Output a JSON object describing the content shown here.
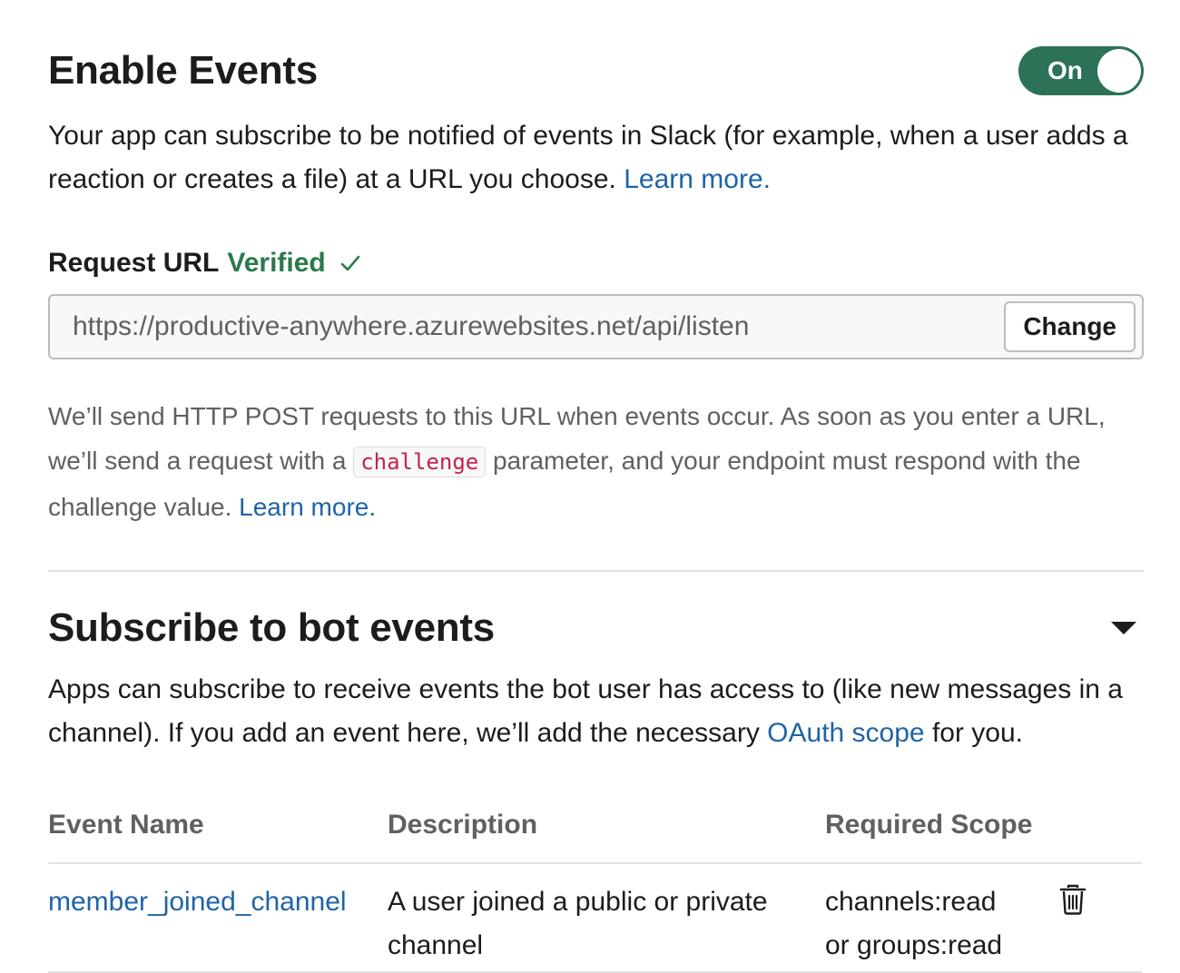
{
  "enable_events": {
    "title": "Enable Events",
    "toggle_label": "On",
    "description": "Your app can subscribe to be notified of events in Slack (for example, when a user adds a reaction or creates a file) at a URL you choose.",
    "learn_more": "Learn more."
  },
  "request_url": {
    "label": "Request URL",
    "status": "Verified",
    "status_icon": "check-icon",
    "value": "https://productive-anywhere.azurewebsites.net/api/listen",
    "change_label": "Change",
    "help_text_1": "We’ll send HTTP POST requests to this URL when events occur. As soon as you enter a URL, we’ll send a request with a",
    "help_code": "challenge",
    "help_text_2": "parameter, and your endpoint must respond with the challenge value.",
    "learn_more": "Learn more."
  },
  "bot_events": {
    "title": "Subscribe to bot events",
    "collapse_icon": "caret-down-icon",
    "description_1": "Apps can subscribe to receive events the bot user has access to (like new messages in a channel). If you add an event here, we’ll add the necessary",
    "oauth_link": "OAuth scope",
    "description_2": "for you.",
    "columns": [
      "Event Name",
      "Description",
      "Required Scope"
    ],
    "rows": [
      {
        "event": "member_joined_channel",
        "description": "A user joined a public or private channel",
        "scope_1": "channels:read",
        "scope_2": "or groups:read",
        "delete_icon": "trash-icon"
      }
    ]
  },
  "colors": {
    "accent_green": "#2b7256",
    "verified_green": "#2b7a4b",
    "link_blue": "#1f64a6",
    "code_red": "#c0254a"
  }
}
